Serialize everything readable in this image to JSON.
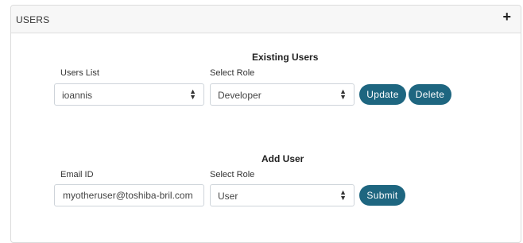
{
  "panel": {
    "title": "USERS",
    "expand_icon": "plus-icon",
    "expand_label": "+"
  },
  "existing": {
    "heading": "Existing Users",
    "users_label": "Users List",
    "users_value": "ioannis",
    "role_label": "Select Role",
    "role_value": "Developer",
    "update_label": "Update",
    "delete_label": "Delete"
  },
  "add": {
    "heading": "Add User",
    "email_label": "Email ID",
    "email_value": "myotheruser@toshiba-bril.com",
    "role_label": "Select Role",
    "role_value": "User",
    "submit_label": "Submit"
  },
  "colors": {
    "button": "#1e6680",
    "header_bg": "#f7f7f7"
  }
}
